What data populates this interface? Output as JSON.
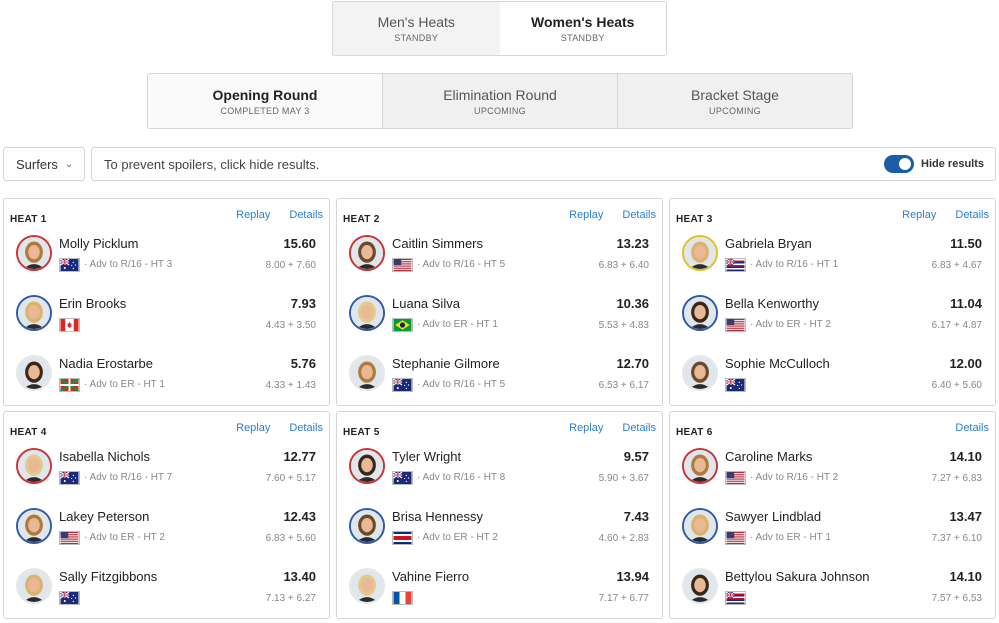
{
  "gender_tabs": [
    {
      "label": "Men's Heats",
      "status": "STANDBY",
      "active": false
    },
    {
      "label": "Women's Heats",
      "status": "STANDBY",
      "active": true
    }
  ],
  "round_tabs": [
    {
      "label": "Opening Round",
      "status": "COMPLETED MAY 3",
      "active": true
    },
    {
      "label": "Elimination Round",
      "status": "UPCOMING",
      "active": false
    },
    {
      "label": "Bracket Stage",
      "status": "UPCOMING",
      "active": false
    }
  ],
  "filter": {
    "surfers_label": "Surfers",
    "spoiler_text": "To prevent spoilers, click hide results.",
    "hide_results_label": "Hide results",
    "hide_results_on": true
  },
  "colors": {
    "accent": "#1b5da6",
    "link": "#2a7fd4",
    "first_place_ring": "#cc3333",
    "second_place_ring": "#2e5aa8",
    "third_place_ring": "#e0c020"
  },
  "heats": [
    {
      "title": "HEAT 1",
      "replay": "Replay",
      "details": "Details",
      "surfers": [
        {
          "name": "Molly Picklum",
          "score": "15.60",
          "flag": "AUS",
          "advance": "· Adv to R/16 - HT 3",
          "waves": "8.00 + 7.60",
          "ring": "red"
        },
        {
          "name": "Erin Brooks",
          "score": "7.93",
          "flag": "CAN",
          "advance": "",
          "waves": "4.43 + 3.50",
          "ring": "blue"
        },
        {
          "name": "Nadia Erostarbe",
          "score": "5.76",
          "flag": "BASQUE",
          "advance": "· Adv to ER - HT 1",
          "waves": "4.33 + 1.43",
          "ring": "white"
        }
      ]
    },
    {
      "title": "HEAT 2",
      "replay": "Replay",
      "details": "Details",
      "surfers": [
        {
          "name": "Caitlin Simmers",
          "score": "13.23",
          "flag": "USA",
          "advance": "· Adv to R/16 - HT 5",
          "waves": "6.83 + 6.40",
          "ring": "red"
        },
        {
          "name": "Luana Silva",
          "score": "10.36",
          "flag": "BRA",
          "advance": "· Adv to ER - HT 1",
          "waves": "5.53 + 4.83",
          "ring": "blue"
        },
        {
          "name": "Stephanie Gilmore",
          "score": "12.70",
          "flag": "AUS",
          "advance": "· Adv to R/16 - HT 5",
          "waves": "6.53 + 6.17",
          "ring": "white"
        }
      ]
    },
    {
      "title": "HEAT 3",
      "replay": "Replay",
      "details": "Details",
      "surfers": [
        {
          "name": "Gabriela Bryan",
          "score": "11.50",
          "flag": "HAW",
          "advance": "· Adv to R/16 - HT 1",
          "waves": "6.83 + 4.67",
          "ring": "yellow"
        },
        {
          "name": "Bella Kenworthy",
          "score": "11.04",
          "flag": "USA",
          "advance": "· Adv to ER - HT 2",
          "waves": "6.17 + 4.87",
          "ring": "blue"
        },
        {
          "name": "Sophie McCulloch",
          "score": "12.00",
          "flag": "AUS",
          "advance": "",
          "waves": "6.40 + 5.60",
          "ring": "white"
        }
      ]
    },
    {
      "title": "HEAT 4",
      "replay": "Replay",
      "details": "Details",
      "surfers": [
        {
          "name": "Isabella Nichols",
          "score": "12.77",
          "flag": "AUS",
          "advance": "· Adv to R/16 - HT 7",
          "waves": "7.60 + 5.17",
          "ring": "red"
        },
        {
          "name": "Lakey Peterson",
          "score": "12.43",
          "flag": "USA",
          "advance": "· Adv to ER - HT 2",
          "waves": "6.83 + 5.60",
          "ring": "blue"
        },
        {
          "name": "Sally Fitzgibbons",
          "score": "13.40",
          "flag": "AUS",
          "advance": "",
          "waves": "7.13 + 6.27",
          "ring": "white"
        }
      ]
    },
    {
      "title": "HEAT 5",
      "replay": "Replay",
      "details": "Details",
      "surfers": [
        {
          "name": "Tyler Wright",
          "score": "9.57",
          "flag": "AUS",
          "advance": "· Adv to R/16 - HT 8",
          "waves": "5.90 + 3.67",
          "ring": "red"
        },
        {
          "name": "Brisa Hennessy",
          "score": "7.43",
          "flag": "CRC",
          "advance": "· Adv to ER - HT 2",
          "waves": "4.60 + 2.83",
          "ring": "blue"
        },
        {
          "name": "Vahine Fierro",
          "score": "13.94",
          "flag": "FRA",
          "advance": "",
          "waves": "7.17 + 6.77",
          "ring": "white"
        }
      ]
    },
    {
      "title": "HEAT 6",
      "replay": "",
      "details": "Details",
      "surfers": [
        {
          "name": "Caroline Marks",
          "score": "14.10",
          "flag": "USA",
          "advance": "· Adv to R/16 - HT 2",
          "waves": "7.27 + 6.83",
          "ring": "red"
        },
        {
          "name": "Sawyer Lindblad",
          "score": "13.47",
          "flag": "USA",
          "advance": "· Adv to ER - HT 1",
          "waves": "7.37 + 6.10",
          "ring": "blue"
        },
        {
          "name": "Bettylou Sakura Johnson",
          "score": "14.10",
          "flag": "HAW",
          "advance": "",
          "waves": "7.57 + 6.53",
          "ring": "white"
        }
      ]
    }
  ]
}
